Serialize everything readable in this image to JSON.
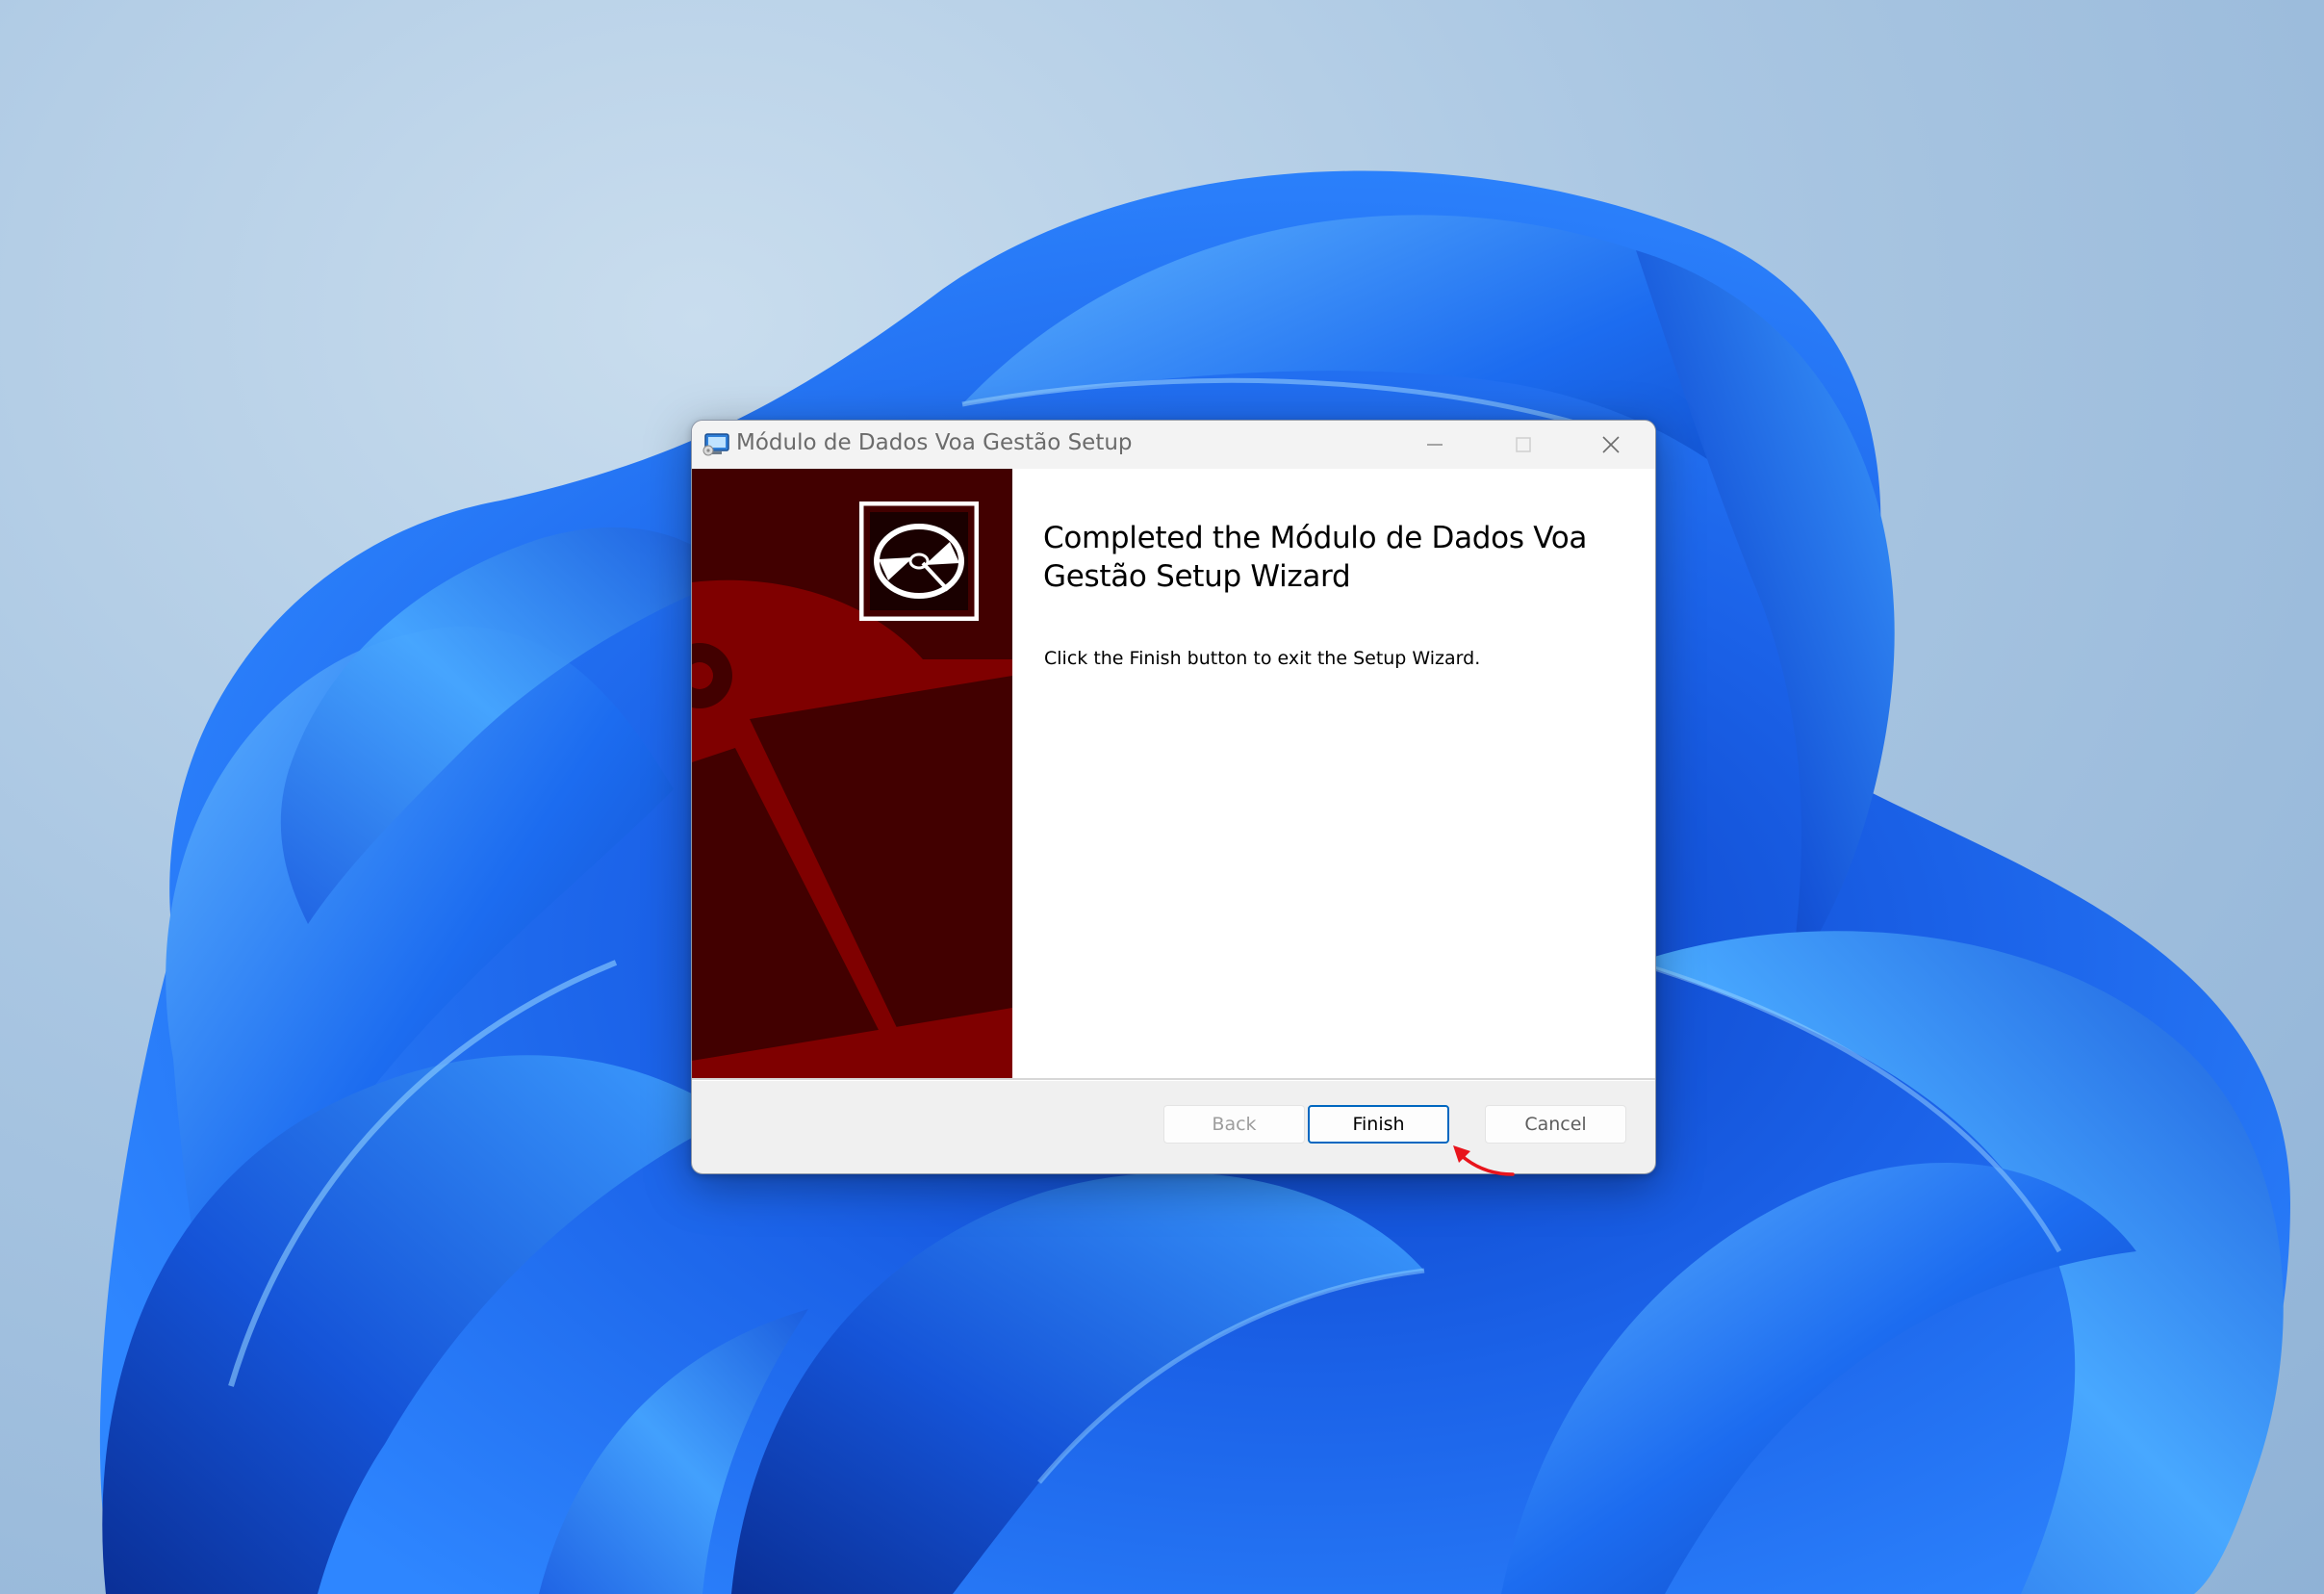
{
  "window": {
    "title": "Módulo de Dados Voa Gestão Setup",
    "app_icon": "installer-icon",
    "controls": {
      "minimize": "minimize-icon",
      "maximize": "maximize-icon",
      "close": "close-icon"
    }
  },
  "wizard": {
    "heading": "Completed the Módulo de Dados Voa Gestão Setup Wizard",
    "body": "Click the Finish button to exit the Setup Wizard.",
    "banner_icon": "disc-icon",
    "colors": {
      "banner_dark": "#420000",
      "banner_accent": "#7f0000",
      "default_button_border": "#0067c0"
    }
  },
  "buttons": {
    "back": "Back",
    "finish": "Finish",
    "cancel": "Cancel"
  },
  "annotation": {
    "pointer": "red-arrow-icon",
    "color": "#e8141c"
  }
}
